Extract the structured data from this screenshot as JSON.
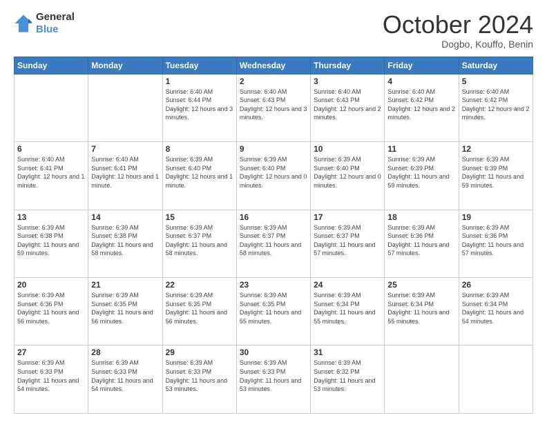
{
  "logo": {
    "line1": "General",
    "line2": "Blue"
  },
  "title": "October 2024",
  "location": "Dogbo, Kouffo, Benin",
  "weekdays": [
    "Sunday",
    "Monday",
    "Tuesday",
    "Wednesday",
    "Thursday",
    "Friday",
    "Saturday"
  ],
  "weeks": [
    [
      {
        "day": "",
        "sunrise": "",
        "sunset": "",
        "daylight": ""
      },
      {
        "day": "",
        "sunrise": "",
        "sunset": "",
        "daylight": ""
      },
      {
        "day": "1",
        "sunrise": "Sunrise: 6:40 AM",
        "sunset": "Sunset: 6:44 PM",
        "daylight": "Daylight: 12 hours and 3 minutes."
      },
      {
        "day": "2",
        "sunrise": "Sunrise: 6:40 AM",
        "sunset": "Sunset: 6:43 PM",
        "daylight": "Daylight: 12 hours and 3 minutes."
      },
      {
        "day": "3",
        "sunrise": "Sunrise: 6:40 AM",
        "sunset": "Sunset: 6:43 PM",
        "daylight": "Daylight: 12 hours and 2 minutes."
      },
      {
        "day": "4",
        "sunrise": "Sunrise: 6:40 AM",
        "sunset": "Sunset: 6:42 PM",
        "daylight": "Daylight: 12 hours and 2 minutes."
      },
      {
        "day": "5",
        "sunrise": "Sunrise: 6:40 AM",
        "sunset": "Sunset: 6:42 PM",
        "daylight": "Daylight: 12 hours and 2 minutes."
      }
    ],
    [
      {
        "day": "6",
        "sunrise": "Sunrise: 6:40 AM",
        "sunset": "Sunset: 6:41 PM",
        "daylight": "Daylight: 12 hours and 1 minute."
      },
      {
        "day": "7",
        "sunrise": "Sunrise: 6:40 AM",
        "sunset": "Sunset: 6:41 PM",
        "daylight": "Daylight: 12 hours and 1 minute."
      },
      {
        "day": "8",
        "sunrise": "Sunrise: 6:39 AM",
        "sunset": "Sunset: 6:40 PM",
        "daylight": "Daylight: 12 hours and 1 minute."
      },
      {
        "day": "9",
        "sunrise": "Sunrise: 6:39 AM",
        "sunset": "Sunset: 6:40 PM",
        "daylight": "Daylight: 12 hours and 0 minutes."
      },
      {
        "day": "10",
        "sunrise": "Sunrise: 6:39 AM",
        "sunset": "Sunset: 6:40 PM",
        "daylight": "Daylight: 12 hours and 0 minutes."
      },
      {
        "day": "11",
        "sunrise": "Sunrise: 6:39 AM",
        "sunset": "Sunset: 6:39 PM",
        "daylight": "Daylight: 11 hours and 59 minutes."
      },
      {
        "day": "12",
        "sunrise": "Sunrise: 6:39 AM",
        "sunset": "Sunset: 6:39 PM",
        "daylight": "Daylight: 11 hours and 59 minutes."
      }
    ],
    [
      {
        "day": "13",
        "sunrise": "Sunrise: 6:39 AM",
        "sunset": "Sunset: 6:38 PM",
        "daylight": "Daylight: 11 hours and 59 minutes."
      },
      {
        "day": "14",
        "sunrise": "Sunrise: 6:39 AM",
        "sunset": "Sunset: 6:38 PM",
        "daylight": "Daylight: 11 hours and 58 minutes."
      },
      {
        "day": "15",
        "sunrise": "Sunrise: 6:39 AM",
        "sunset": "Sunset: 6:37 PM",
        "daylight": "Daylight: 11 hours and 58 minutes."
      },
      {
        "day": "16",
        "sunrise": "Sunrise: 6:39 AM",
        "sunset": "Sunset: 6:37 PM",
        "daylight": "Daylight: 11 hours and 58 minutes."
      },
      {
        "day": "17",
        "sunrise": "Sunrise: 6:39 AM",
        "sunset": "Sunset: 6:37 PM",
        "daylight": "Daylight: 11 hours and 57 minutes."
      },
      {
        "day": "18",
        "sunrise": "Sunrise: 6:39 AM",
        "sunset": "Sunset: 6:36 PM",
        "daylight": "Daylight: 11 hours and 57 minutes."
      },
      {
        "day": "19",
        "sunrise": "Sunrise: 6:39 AM",
        "sunset": "Sunset: 6:36 PM",
        "daylight": "Daylight: 11 hours and 57 minutes."
      }
    ],
    [
      {
        "day": "20",
        "sunrise": "Sunrise: 6:39 AM",
        "sunset": "Sunset: 6:36 PM",
        "daylight": "Daylight: 11 hours and 56 minutes."
      },
      {
        "day": "21",
        "sunrise": "Sunrise: 6:39 AM",
        "sunset": "Sunset: 6:35 PM",
        "daylight": "Daylight: 11 hours and 56 minutes."
      },
      {
        "day": "22",
        "sunrise": "Sunrise: 6:39 AM",
        "sunset": "Sunset: 6:35 PM",
        "daylight": "Daylight: 11 hours and 56 minutes."
      },
      {
        "day": "23",
        "sunrise": "Sunrise: 6:39 AM",
        "sunset": "Sunset: 6:35 PM",
        "daylight": "Daylight: 11 hours and 55 minutes."
      },
      {
        "day": "24",
        "sunrise": "Sunrise: 6:39 AM",
        "sunset": "Sunset: 6:34 PM",
        "daylight": "Daylight: 11 hours and 55 minutes."
      },
      {
        "day": "25",
        "sunrise": "Sunrise: 6:39 AM",
        "sunset": "Sunset: 6:34 PM",
        "daylight": "Daylight: 11 hours and 55 minutes."
      },
      {
        "day": "26",
        "sunrise": "Sunrise: 6:39 AM",
        "sunset": "Sunset: 6:34 PM",
        "daylight": "Daylight: 11 hours and 54 minutes."
      }
    ],
    [
      {
        "day": "27",
        "sunrise": "Sunrise: 6:39 AM",
        "sunset": "Sunset: 6:33 PM",
        "daylight": "Daylight: 11 hours and 54 minutes."
      },
      {
        "day": "28",
        "sunrise": "Sunrise: 6:39 AM",
        "sunset": "Sunset: 6:33 PM",
        "daylight": "Daylight: 11 hours and 54 minutes."
      },
      {
        "day": "29",
        "sunrise": "Sunrise: 6:39 AM",
        "sunset": "Sunset: 6:33 PM",
        "daylight": "Daylight: 11 hours and 53 minutes."
      },
      {
        "day": "30",
        "sunrise": "Sunrise: 6:39 AM",
        "sunset": "Sunset: 6:33 PM",
        "daylight": "Daylight: 11 hours and 53 minutes."
      },
      {
        "day": "31",
        "sunrise": "Sunrise: 6:39 AM",
        "sunset": "Sunset: 6:32 PM",
        "daylight": "Daylight: 11 hours and 53 minutes."
      },
      {
        "day": "",
        "sunrise": "",
        "sunset": "",
        "daylight": ""
      },
      {
        "day": "",
        "sunrise": "",
        "sunset": "",
        "daylight": ""
      }
    ]
  ]
}
